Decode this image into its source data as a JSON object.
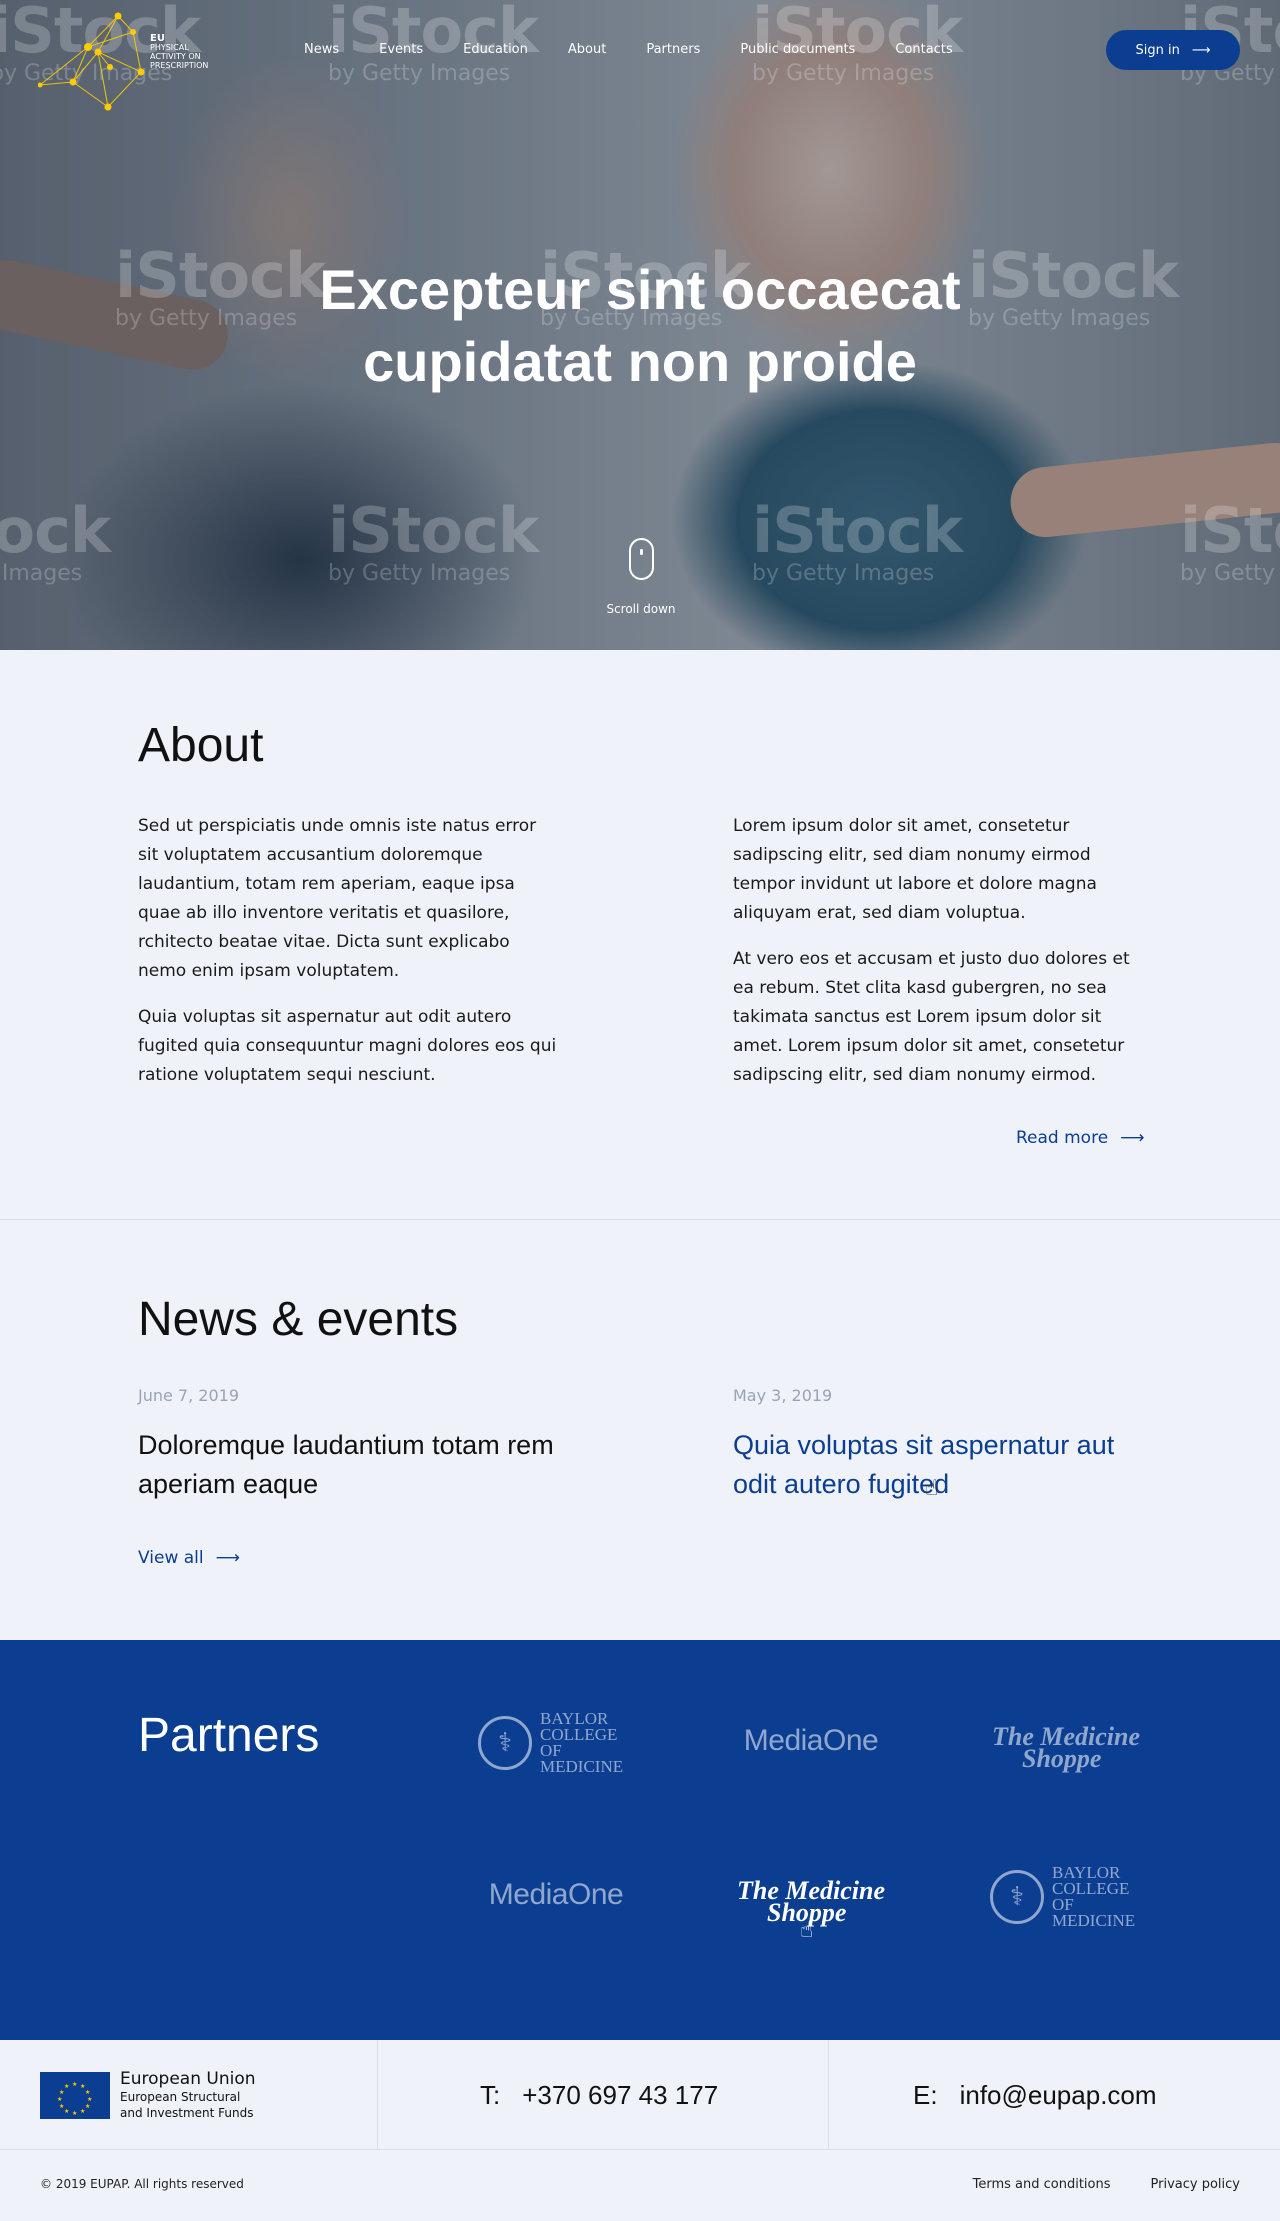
{
  "header": {
    "logo": {
      "line1": "EU",
      "line2": "Physical",
      "line3": "Activity on",
      "line4": "Prescription"
    },
    "nav": [
      "News",
      "Events",
      "Education",
      "About",
      "Partners",
      "Public documents",
      "Contacts"
    ],
    "signin_label": "Sign in"
  },
  "hero": {
    "title_line1": "Excepteur sint occaecat",
    "title_line2": "cupidatat non proide",
    "scroll_label": "Scroll down",
    "watermark_brand": "iStock",
    "watermark_sub": "by Getty Images"
  },
  "about": {
    "title": "About",
    "left": [
      "Sed ut perspiciatis unde omnis iste natus error sit voluptatem accusantium doloremque laudantium, totam rem aperiam, eaque ipsa quae ab illo inventore veritatis et quasilore, rchitecto beatae vitae. Dicta sunt explicabo nemo enim ipsam voluptatem.",
      "Quia voluptas sit aspernatur aut odit autero fugited quia consequuntur magni dolores eos qui ratione voluptatem sequi nesciunt."
    ],
    "right": [
      "Lorem ipsum dolor sit amet, consetetur sadipscing elitr, sed diam nonumy eirmod tempor invidunt ut labore et dolore magna aliquyam erat, sed diam voluptua.",
      "At vero eos et accusam et justo duo dolores et ea rebum. Stet clita kasd gubergren, no sea takimata sanctus est Lorem ipsum dolor sit amet. Lorem ipsum dolor sit amet, consetetur sadipscing elitr, sed diam nonumy eirmod."
    ],
    "read_more": "Read more"
  },
  "news": {
    "title": "News & events",
    "items": [
      {
        "date": "June 7, 2019",
        "title": "Doloremque laudantium totam rem aperiam eaque"
      },
      {
        "date": "May 3, 2019",
        "title": "Quia voluptas sit aspernatur aut odit autero fugited"
      }
    ],
    "view_all": "View all"
  },
  "partners": {
    "title": "Partners",
    "baylor": [
      "Baylor",
      "College",
      "of",
      "Medicine"
    ],
    "mediaone": "MediaOne",
    "medicine_line1": "The Medicine",
    "medicine_line2": "Shoppe"
  },
  "footer": {
    "eu_title": "European Union",
    "eu_sub1": "European Structural",
    "eu_sub2": "and Investment Funds",
    "phone_label": "T:",
    "phone": "+370 697 43 177",
    "email_label": "E:",
    "email": "info@eupap.com",
    "copyright": "© 2019 EUPAP. All rights reserved",
    "terms": "Terms and conditions",
    "privacy": "Privacy policy"
  },
  "colors": {
    "brand_blue": "#0b3d91",
    "page_bg": "#eff2f9",
    "accent_yellow": "#ffcc00"
  }
}
